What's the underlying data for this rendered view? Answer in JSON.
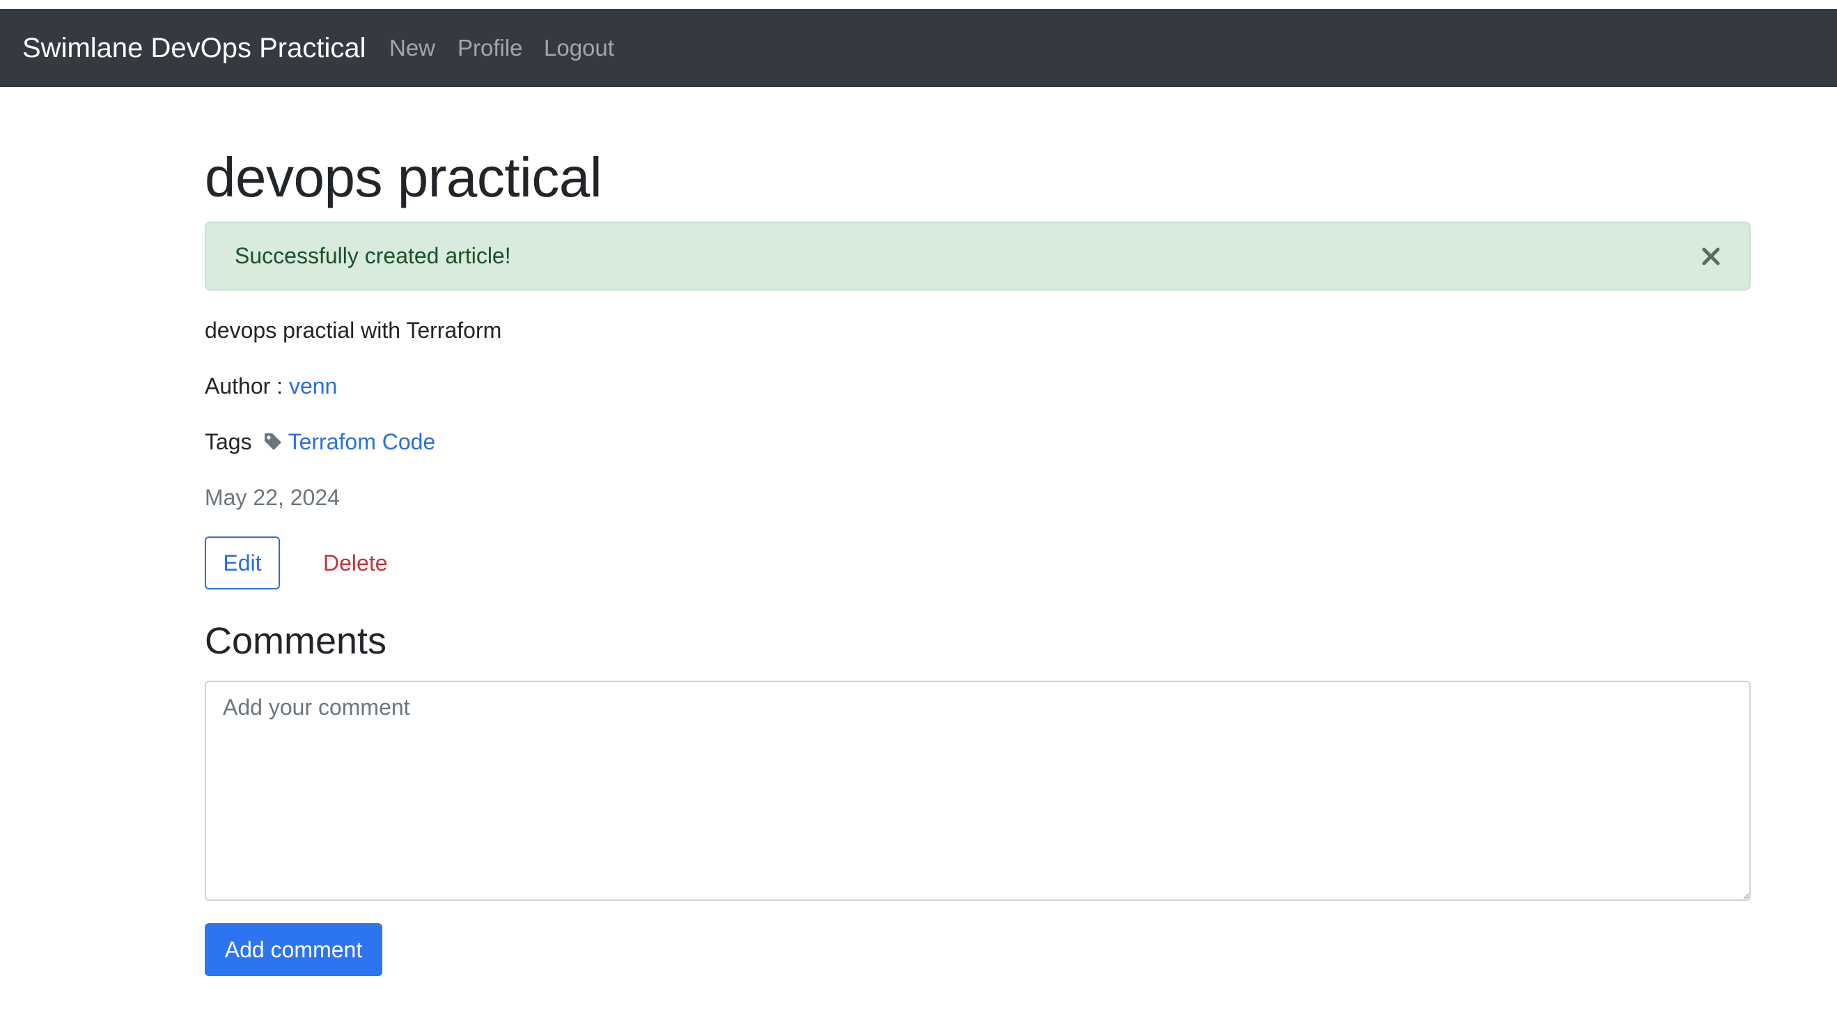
{
  "navbar": {
    "brand": "Swimlane DevOps Practical",
    "links": [
      {
        "label": "New"
      },
      {
        "label": "Profile"
      },
      {
        "label": "Logout"
      }
    ],
    "background": "#343a40"
  },
  "article": {
    "title": "devops practical",
    "alert": {
      "message": "Successfully created article!",
      "close_icon": "close-icon"
    },
    "description": "devops practial with Terraform",
    "author_label": "Author :",
    "author": "venn",
    "tags_label": "Tags",
    "tag_icon": "tag-icon",
    "tag": "Terrafom Code",
    "date": "May 22, 2024",
    "edit_label": "Edit",
    "delete_label": "Delete"
  },
  "comments": {
    "heading": "Comments",
    "input_placeholder": "Add your comment",
    "input_value": "",
    "submit_label": "Add comment"
  },
  "colors": {
    "link": "#2a6fdb",
    "delete": "#c0343b",
    "alert_bg": "#d9ebdd",
    "alert_text": "#195229",
    "primary_button": "#2d74f0"
  }
}
